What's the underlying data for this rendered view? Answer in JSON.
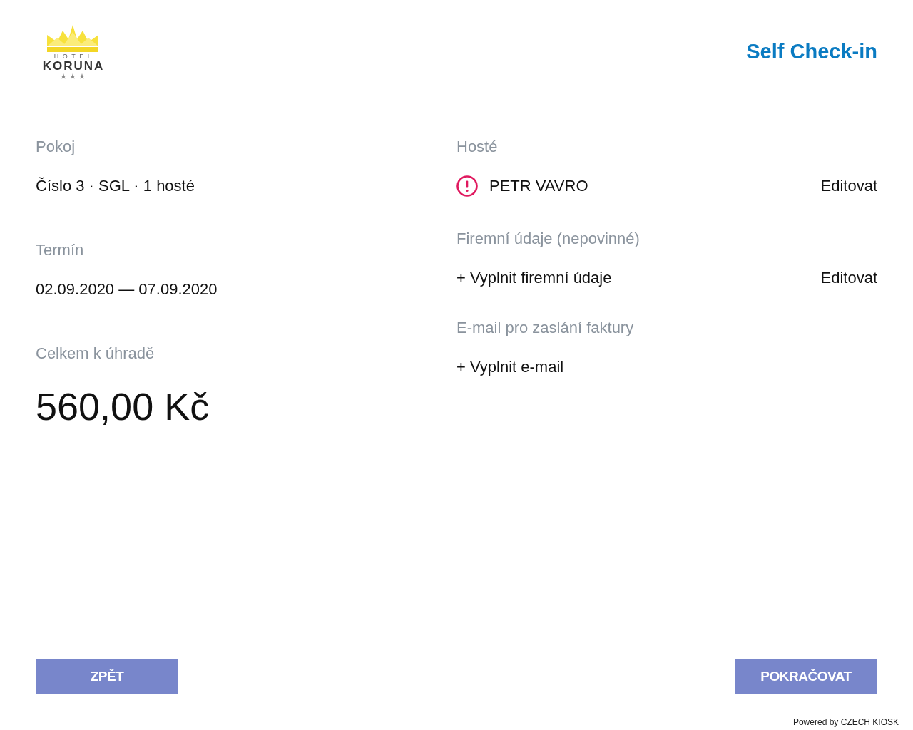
{
  "header": {
    "logo": {
      "line_1": "HOTEL",
      "line_2": "KORUNA",
      "stars": 3
    },
    "title": "Self Check-in"
  },
  "summary": [
    {
      "kind": "text",
      "label": "Pokoj",
      "value": "Číslo 3 · SGL · 1 hosté"
    },
    {
      "kind": "text",
      "label": "Termín",
      "value": "02.09.2020 — 07.09.2020"
    },
    {
      "kind": "amount",
      "label": "Celkem k úhradě",
      "value": "560,00 Kč"
    }
  ],
  "guests": {
    "label": "Hosté",
    "items": [
      {
        "name": "PETR VAVRO",
        "incomplete": true,
        "action": "Editovat"
      }
    ]
  },
  "company": {
    "label": "Firemní údaje (nepovinné)",
    "link": "+ Vyplnit firemní údaje",
    "action": "Editovat"
  },
  "email": {
    "label": "E-mail pro zaslání faktury",
    "link": "+ Vyplnit e-mail"
  },
  "buttons": [
    {
      "label": "ZPĚT"
    },
    {
      "label": "POKRAČOVAT"
    }
  ],
  "footer": "Powered by CZECH KIOSK"
}
